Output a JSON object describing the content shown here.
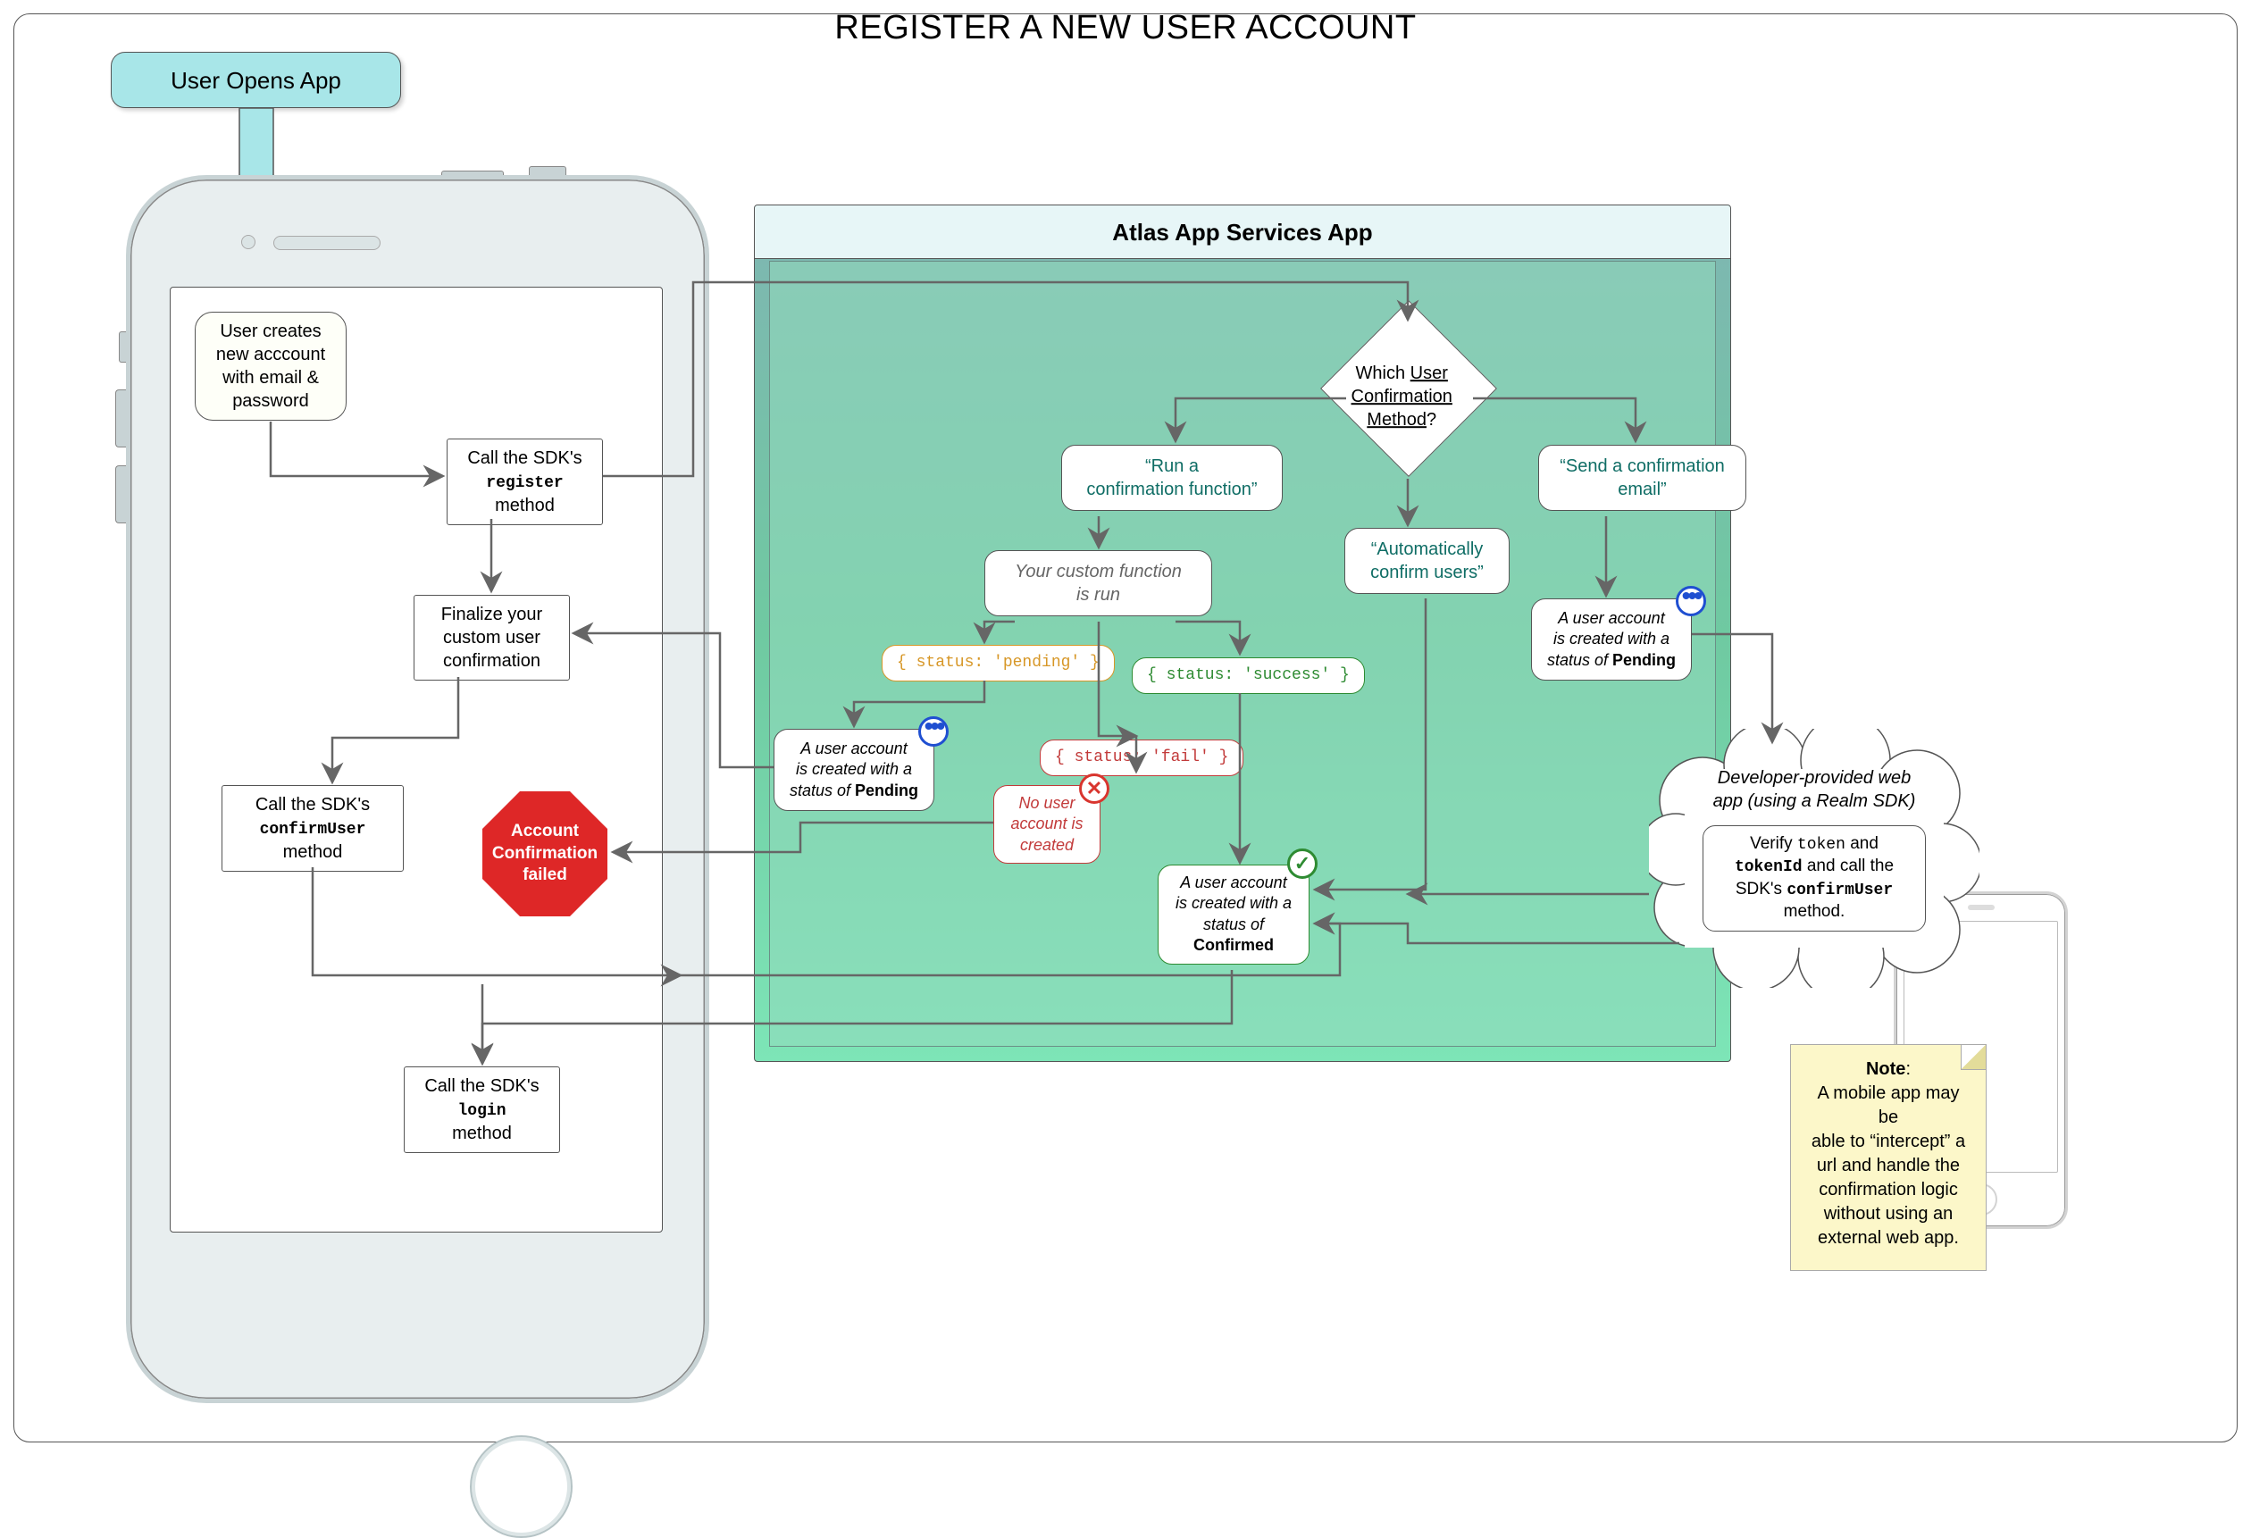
{
  "title": "REGISTER A NEW USER ACCOUNT",
  "start": {
    "label": "User Opens App"
  },
  "phone": {
    "step1_l1": "User creates",
    "step1_l2": "new acccount",
    "step1_l3": "with email &",
    "step1_l4": "password",
    "step2_l1": "Call the SDK's",
    "step2_l2": "register",
    "step2_l3": "method",
    "step3_l1": "Finalize your",
    "step3_l2": "custom user",
    "step3_l3": "confirmation",
    "step4_l1": "Call the SDK's",
    "step4_l2": "confirmUser",
    "step4_l3": "method",
    "step5_l1": "Call the SDK's",
    "step5_l2": "login",
    "step5_l3": "method",
    "fail_l1": "Account",
    "fail_l2": "Confirmation",
    "fail_l3": "failed"
  },
  "atlas": {
    "header": "Atlas App Services App",
    "decision_l1": "Which",
    "decision_l2_underline": "User Confirmation Method",
    "decision_l3": "?",
    "branch_run_l1": "“Run a",
    "branch_run_l2": "confirmation function”",
    "branch_auto_l1": "“Automatically",
    "branch_auto_l2": "confirm users”",
    "branch_email_l1": "“Send a confirmation",
    "branch_email_l2": "email”",
    "custom_fn_l1": "Your custom function",
    "custom_fn_l2": "is run",
    "status_pending": "{ status: 'pending' }",
    "status_success": "{ status: 'success' }",
    "status_fail": "{ status: 'fail' }",
    "pending_box_l1": "A user account",
    "pending_box_l2": "is created with a",
    "pending_box_l3_a": "status of ",
    "pending_box_l3_b": "Pending",
    "fail_box_l1": "No user",
    "fail_box_l2": "account is",
    "fail_box_l3": "created",
    "confirmed_box_l1": "A user account",
    "confirmed_box_l2": "is created  with a",
    "confirmed_box_l3": "status of",
    "confirmed_box_l4": "Confirmed",
    "email_pending_l1": "A user account",
    "email_pending_l2": "is created with a",
    "email_pending_l3_a": "status of ",
    "email_pending_l3_b": "Pending"
  },
  "cloud": {
    "title_l1": "Developer-provided web",
    "title_l2": "app (using a Realm SDK)",
    "body_pre1": "Verify ",
    "body_code1": "token",
    "body_mid1": " and",
    "body_code2": "tokenId",
    "body_mid2": " and call the",
    "body_l3": "SDK's ",
    "body_code3": "confirmUser",
    "body_l4": "method."
  },
  "note": {
    "heading": "Note",
    "body_l1": "A mobile app may be",
    "body_l2": "able to “intercept” a",
    "body_l3": "url and handle the",
    "body_l4": "confirmation logic",
    "body_l5": "without using an",
    "body_l6": "external web app."
  },
  "colors": {
    "start_bg": "#a8e6e8",
    "pending": "#d79727",
    "success": "#2e8b32",
    "fail": "#c23a3a",
    "red_box": "#de2727",
    "note_bg": "#fcf7c9"
  }
}
